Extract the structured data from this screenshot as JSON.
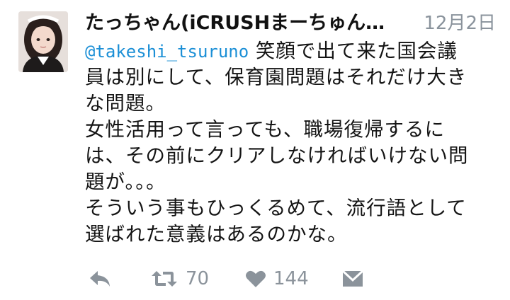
{
  "tweet": {
    "display_name": "たっちゃん(iCRUSHまーちゅんT…",
    "timestamp": "12月2日",
    "mention": "@takeshi_tsuruno",
    "text_lines": [
      " 笑顔で出て来た国会議",
      "員は別にして、保育園問題はそれだけ大き",
      "な問題。",
      "女性活用って言っても、職場復帰するに",
      "は、その前にクリアしなければいけない問",
      "題が。。。",
      "そういう事もひっくるめて、流行語として",
      "選ばれた意義はあるのかな。"
    ]
  },
  "actions": {
    "reply_icon": "reply-icon",
    "retweet_icon": "retweet-icon",
    "retweet_count": "70",
    "like_icon": "heart-icon",
    "like_count": "144",
    "dm_icon": "envelope-icon"
  },
  "colors": {
    "mention": "#1b8fd6",
    "muted": "#8b939b",
    "text": "#141414"
  }
}
